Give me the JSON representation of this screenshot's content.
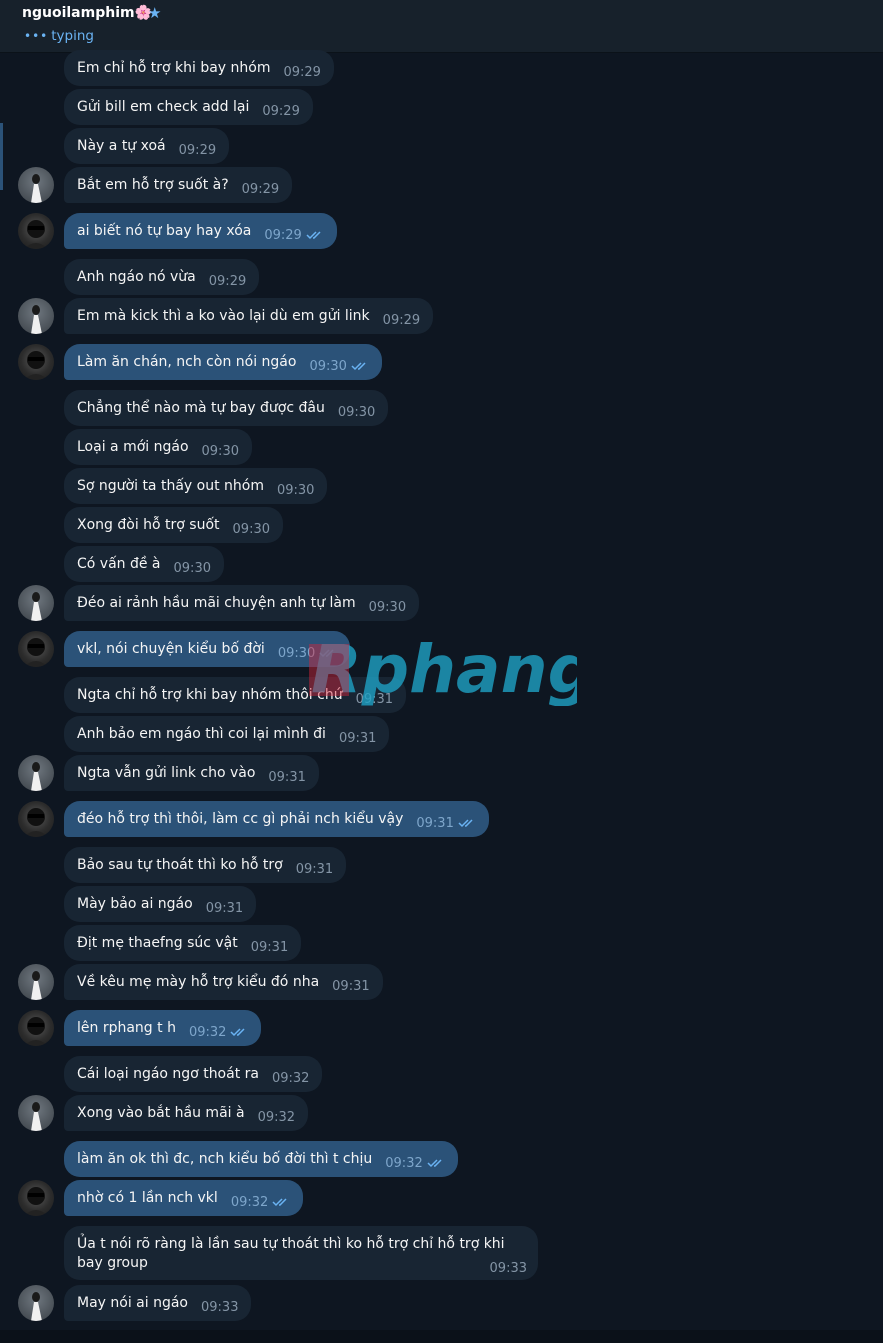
{
  "header": {
    "title": "nguoilamphim",
    "title_emoji": "🌸",
    "verified_icon": "star-icon",
    "status": "typing",
    "status_dots": "•••"
  },
  "colors": {
    "background": "#0e1621",
    "incoming_bubble": "#182533",
    "outgoing_bubble": "#2b5278",
    "accent": "#6ab3f3",
    "time_text": "#8495a6"
  },
  "watermark": {
    "text": "Rphang"
  },
  "messages": [
    {
      "text": "Em chỉ hỗ trợ khi bay nhóm",
      "time": "09:29",
      "dir": "in"
    },
    {
      "text": "Gửi bill em check add lại",
      "time": "09:29",
      "dir": "in"
    },
    {
      "text": "Này a tự xoá",
      "time": "09:29",
      "dir": "in"
    },
    {
      "text": "Bắt em hỗ trợ suốt à?",
      "time": "09:29",
      "dir": "in",
      "avatar": "white"
    },
    {
      "text": "ai biết nó tự bay hay xóa",
      "time": "09:29",
      "dir": "out",
      "avatar": "dark"
    },
    {
      "text": "Anh ngáo nó vừa",
      "time": "09:29",
      "dir": "in"
    },
    {
      "text": "Em mà kick thì a ko vào lại dù em gửi link",
      "time": "09:29",
      "dir": "in",
      "avatar": "white"
    },
    {
      "text": "Làm ăn chán, nch còn nói ngáo",
      "time": "09:30",
      "dir": "out",
      "avatar": "dark"
    },
    {
      "text": "Chẳng thể nào mà tự bay được đâu",
      "time": "09:30",
      "dir": "in"
    },
    {
      "text": "Loại a mới ngáo",
      "time": "09:30",
      "dir": "in"
    },
    {
      "text": "Sợ người ta thấy out nhóm",
      "time": "09:30",
      "dir": "in"
    },
    {
      "text": "Xong đòi hỗ trợ suốt",
      "time": "09:30",
      "dir": "in"
    },
    {
      "text": "Có vấn đề à",
      "time": "09:30",
      "dir": "in"
    },
    {
      "text": "Đéo ai rảnh hầu mãi chuyện anh tự làm",
      "time": "09:30",
      "dir": "in",
      "avatar": "white"
    },
    {
      "text": "vkl, nói chuyện kiểu bố đời",
      "time": "09:30",
      "dir": "out",
      "avatar": "dark"
    },
    {
      "text": "Ngta chỉ hỗ trợ khi bay nhóm thôi chứ",
      "time": "09:31",
      "dir": "in"
    },
    {
      "text": "Anh bảo em ngáo thì coi lại mình đi",
      "time": "09:31",
      "dir": "in"
    },
    {
      "text": "Ngta vẫn gửi link cho vào",
      "time": "09:31",
      "dir": "in",
      "avatar": "white"
    },
    {
      "text": "đéo hỗ trợ thì thôi, làm cc gì phải nch kiểu vậy",
      "time": "09:31",
      "dir": "out",
      "avatar": "dark"
    },
    {
      "text": "Bảo sau tự thoát thì ko hỗ trợ",
      "time": "09:31",
      "dir": "in"
    },
    {
      "text": "Mày bảo ai ngáo",
      "time": "09:31",
      "dir": "in"
    },
    {
      "text": "Địt mẹ thaefng súc vật",
      "time": "09:31",
      "dir": "in"
    },
    {
      "text": "Về kêu mẹ mày hỗ trợ kiểu đó nha",
      "time": "09:31",
      "dir": "in",
      "avatar": "white"
    },
    {
      "text": "lên rphang t h",
      "time": "09:32",
      "dir": "out",
      "avatar": "dark"
    },
    {
      "text": "Cái loại ngáo ngơ thoát ra",
      "time": "09:32",
      "dir": "in"
    },
    {
      "text": "Xong vào bắt hầu mãi à",
      "time": "09:32",
      "dir": "in",
      "avatar": "white"
    },
    {
      "text": "làm ăn ok thì đc, nch kiểu bố đời thì t chịu",
      "time": "09:32",
      "dir": "out"
    },
    {
      "text": "nhờ có 1 lần nch vkl",
      "time": "09:32",
      "dir": "out",
      "avatar": "dark"
    },
    {
      "text": "Ủa t nói rõ ràng là lần sau tự thoát thì ko hỗ trợ chỉ hỗ trợ khi bay group",
      "time": "09:33",
      "dir": "in"
    },
    {
      "text": "May nói ai ngáo",
      "time": "09:33",
      "dir": "in",
      "avatar": "white"
    }
  ]
}
